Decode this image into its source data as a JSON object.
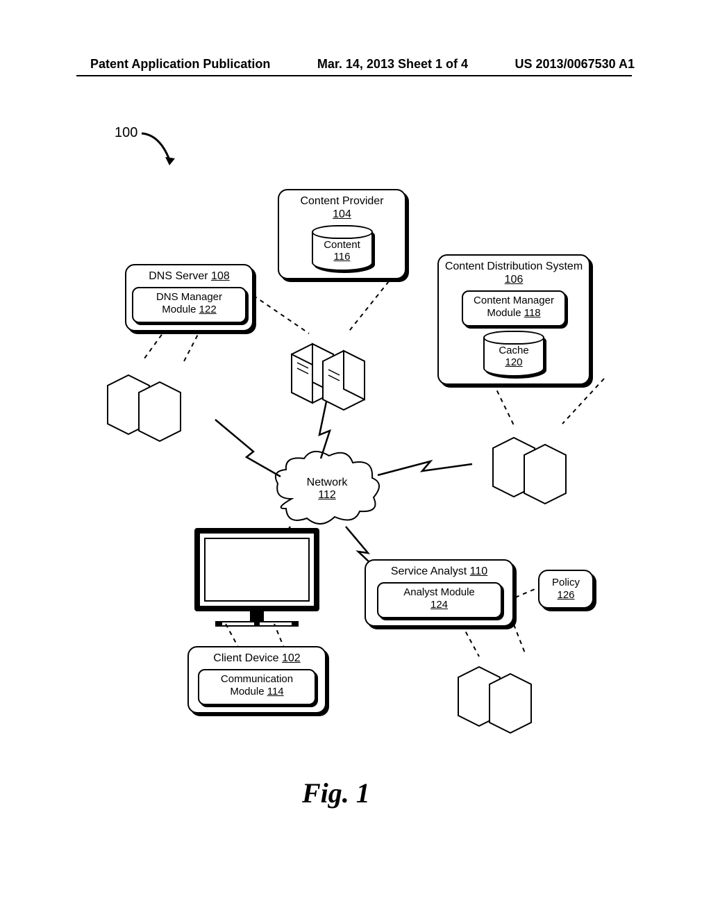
{
  "header": {
    "left": "Patent Application Publication",
    "center": "Mar. 14, 2013  Sheet 1 of 4",
    "right": "US 2013/0067530 A1"
  },
  "system_number": "100",
  "figure_label": "Fig. 1",
  "content_provider": {
    "title": "Content Provider",
    "num": "104",
    "cyl_label": "Content",
    "cyl_num": "116"
  },
  "dns_server": {
    "title": "DNS Server",
    "title_num": "108",
    "module": "DNS Manager Module",
    "module_num": "122"
  },
  "cds": {
    "title": "Content Distribution System",
    "title_num": "106",
    "module": "Content Manager Module",
    "module_num": "118",
    "cyl_label": "Cache",
    "cyl_num": "120"
  },
  "network": {
    "label": "Network",
    "num": "112"
  },
  "service_analyst": {
    "title": "Service Analyst",
    "title_num": "110",
    "module": "Analyst Module",
    "module_num": "124"
  },
  "policy": {
    "title": "Policy",
    "num": "126"
  },
  "client": {
    "title": "Client Device",
    "title_num": "102",
    "module": "Communication Module",
    "module_num": "114"
  }
}
